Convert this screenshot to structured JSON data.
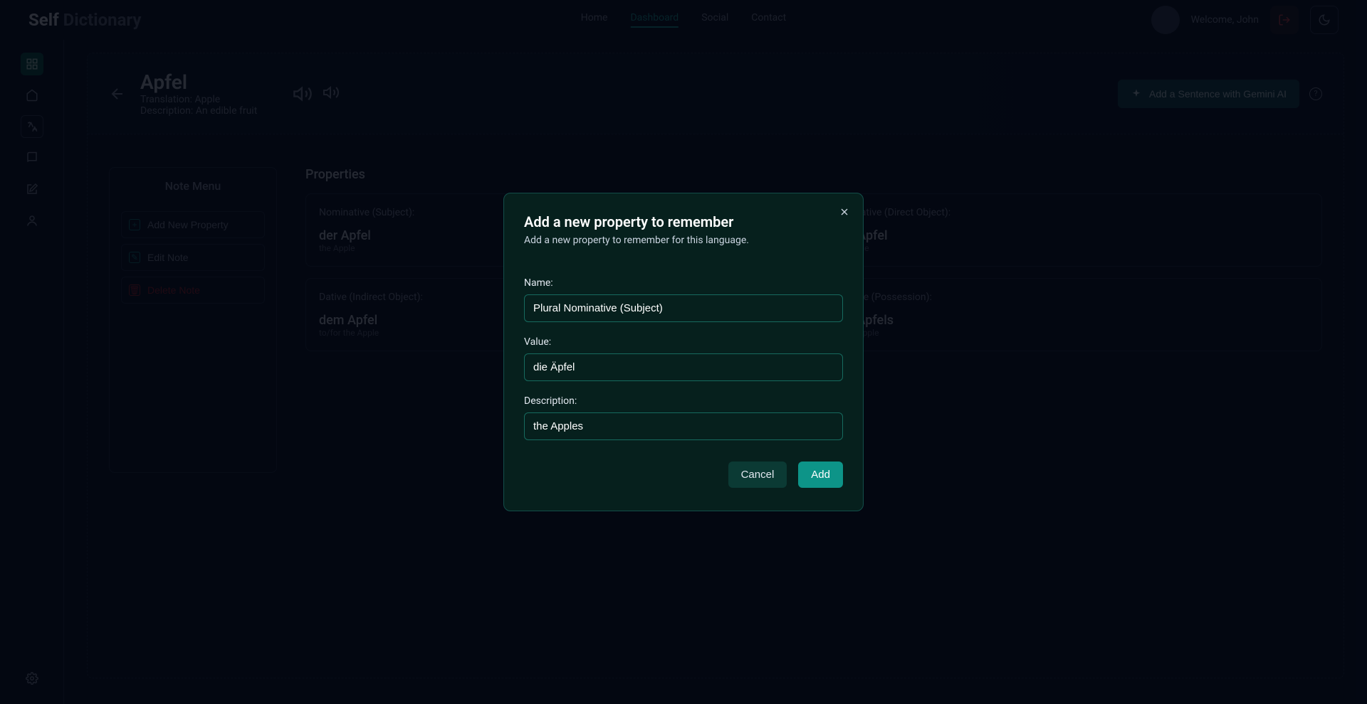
{
  "logo": {
    "self": "Self",
    "dict": "Dictionary"
  },
  "nav": {
    "home": "Home",
    "dashboard": "Dashboard",
    "social": "Social",
    "contact": "Contact"
  },
  "user": {
    "welcome": "Welcome, John"
  },
  "word": {
    "title": "Apfel",
    "translation": "Translation: Apple",
    "description": "Description: An edible fruit"
  },
  "actions": {
    "gemini": "Add a Sentence with Gemini AI"
  },
  "note_menu": {
    "title": "Note Menu",
    "add_property": "Add New Property",
    "edit": "Edit Note",
    "delete": "Delete Note"
  },
  "properties_heading": "Properties",
  "properties": [
    {
      "title": "Nominative (Subject):",
      "value": "der Apfel",
      "desc": "the Apple"
    },
    {
      "title": "Accusative (Direct Object):",
      "value": "den Apfel",
      "desc": "the Apple"
    },
    {
      "title": "Dative (Indirect Object):",
      "value": "dem Apfel",
      "desc": "to/for the Apple"
    },
    {
      "title": "Genitive (Possession):",
      "value": "des Apfels",
      "desc": "of the Apple"
    }
  ],
  "modal": {
    "title": "Add a new property to remember",
    "subtitle": "Add a new property to remember for this language.",
    "labels": {
      "name": "Name:",
      "value": "Value:",
      "desc": "Description:"
    },
    "values": {
      "name": "Plural Nominative (Subject)",
      "value": "die Äpfel",
      "desc": "the Apples"
    },
    "cancel": "Cancel",
    "add": "Add"
  }
}
